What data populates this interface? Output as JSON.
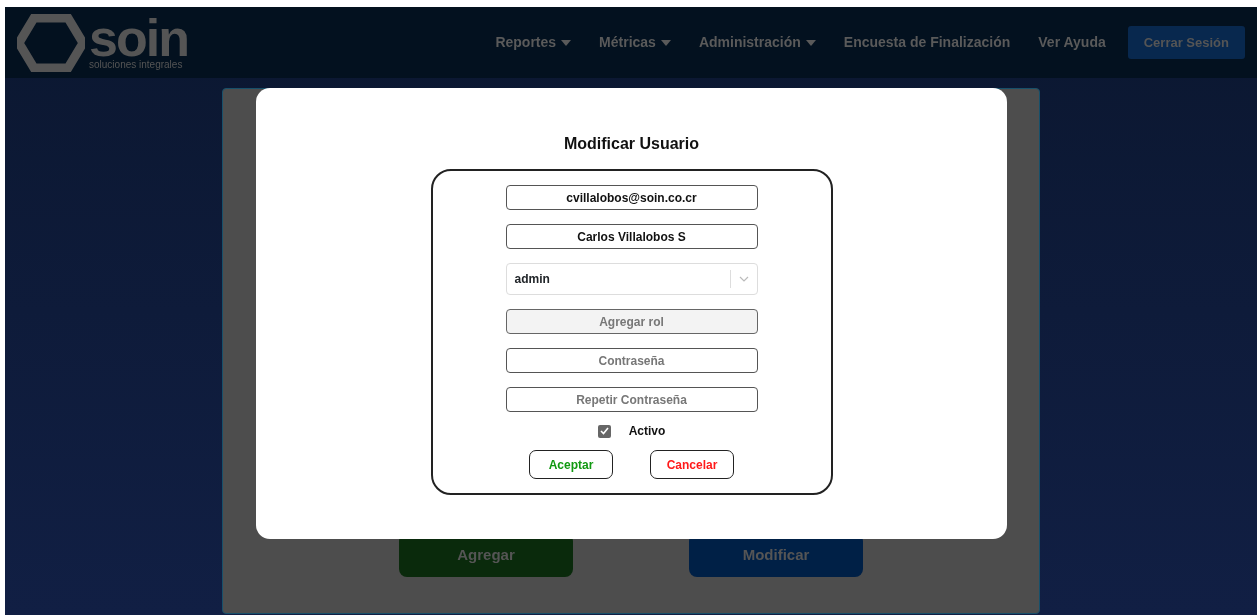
{
  "logo": {
    "name": "soin",
    "tagline": "soluciones integrales"
  },
  "nav": [
    {
      "label": "Reportes",
      "dropdown": true
    },
    {
      "label": "Métricas",
      "dropdown": true
    },
    {
      "label": "Administración",
      "dropdown": true
    },
    {
      "label": "Encuesta de Finalización",
      "dropdown": false
    },
    {
      "label": "Ver Ayuda",
      "dropdown": false
    }
  ],
  "logout": "Cerrar Sesión",
  "background_buttons": [
    {
      "label": "Agregar",
      "color": "#0a2a0c"
    },
    {
      "label": "Modificar",
      "color": "#002046"
    }
  ],
  "modal": {
    "title": "Modificar Usuario",
    "fields": [
      {
        "kind": "text",
        "value": "cvillalobos@soin.co.cr"
      },
      {
        "kind": "text",
        "value": "Carlos Villalobos S"
      },
      {
        "kind": "select",
        "value": "admin"
      },
      {
        "kind": "button",
        "label": "Agregar rol"
      },
      {
        "kind": "text",
        "placeholder": "Contraseña"
      },
      {
        "kind": "text",
        "placeholder": "Repetir Contraseña"
      }
    ],
    "active": {
      "label": "Activo",
      "checked": true
    },
    "buttons": [
      {
        "label": "Aceptar",
        "color": "#119911"
      },
      {
        "label": "Cancelar",
        "color": "#ff1a1a"
      }
    ]
  }
}
